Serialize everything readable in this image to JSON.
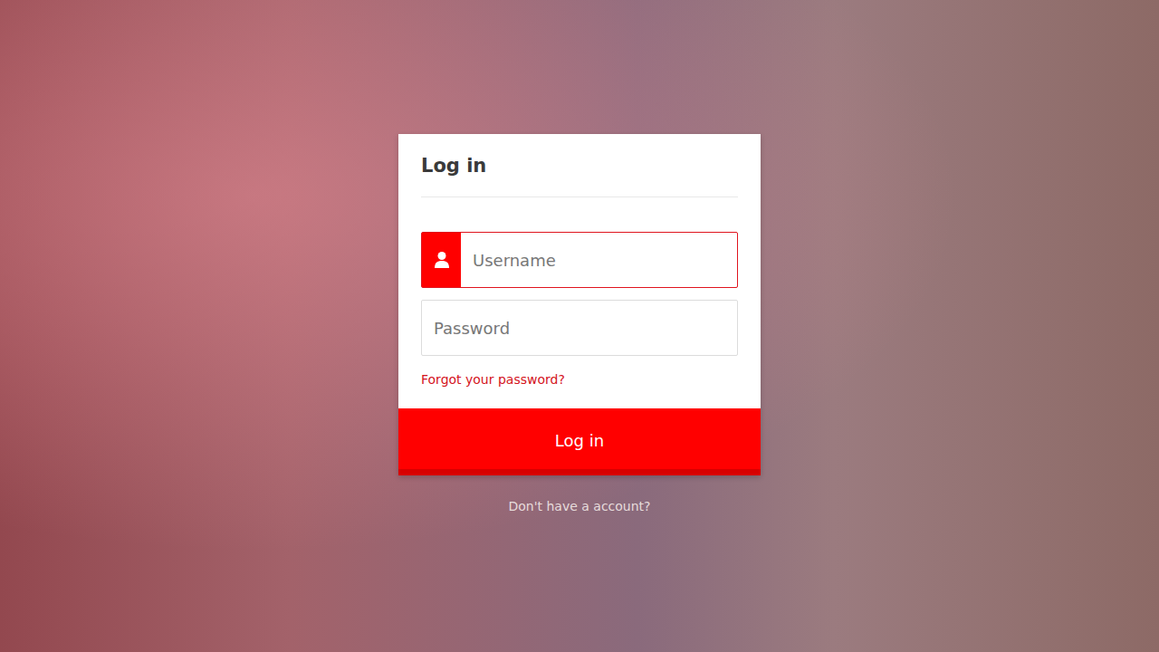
{
  "card": {
    "title": "Log in"
  },
  "fields": [
    {
      "name": "username",
      "kind": "icon",
      "placeholder": "Username",
      "focused": true
    },
    {
      "name": "password",
      "kind": "plain",
      "placeholder": "Password",
      "focused": false
    }
  ],
  "forgot_link": "Forgot your password?",
  "submit_button": "Log in",
  "signup_link": "Don't have a account?"
}
